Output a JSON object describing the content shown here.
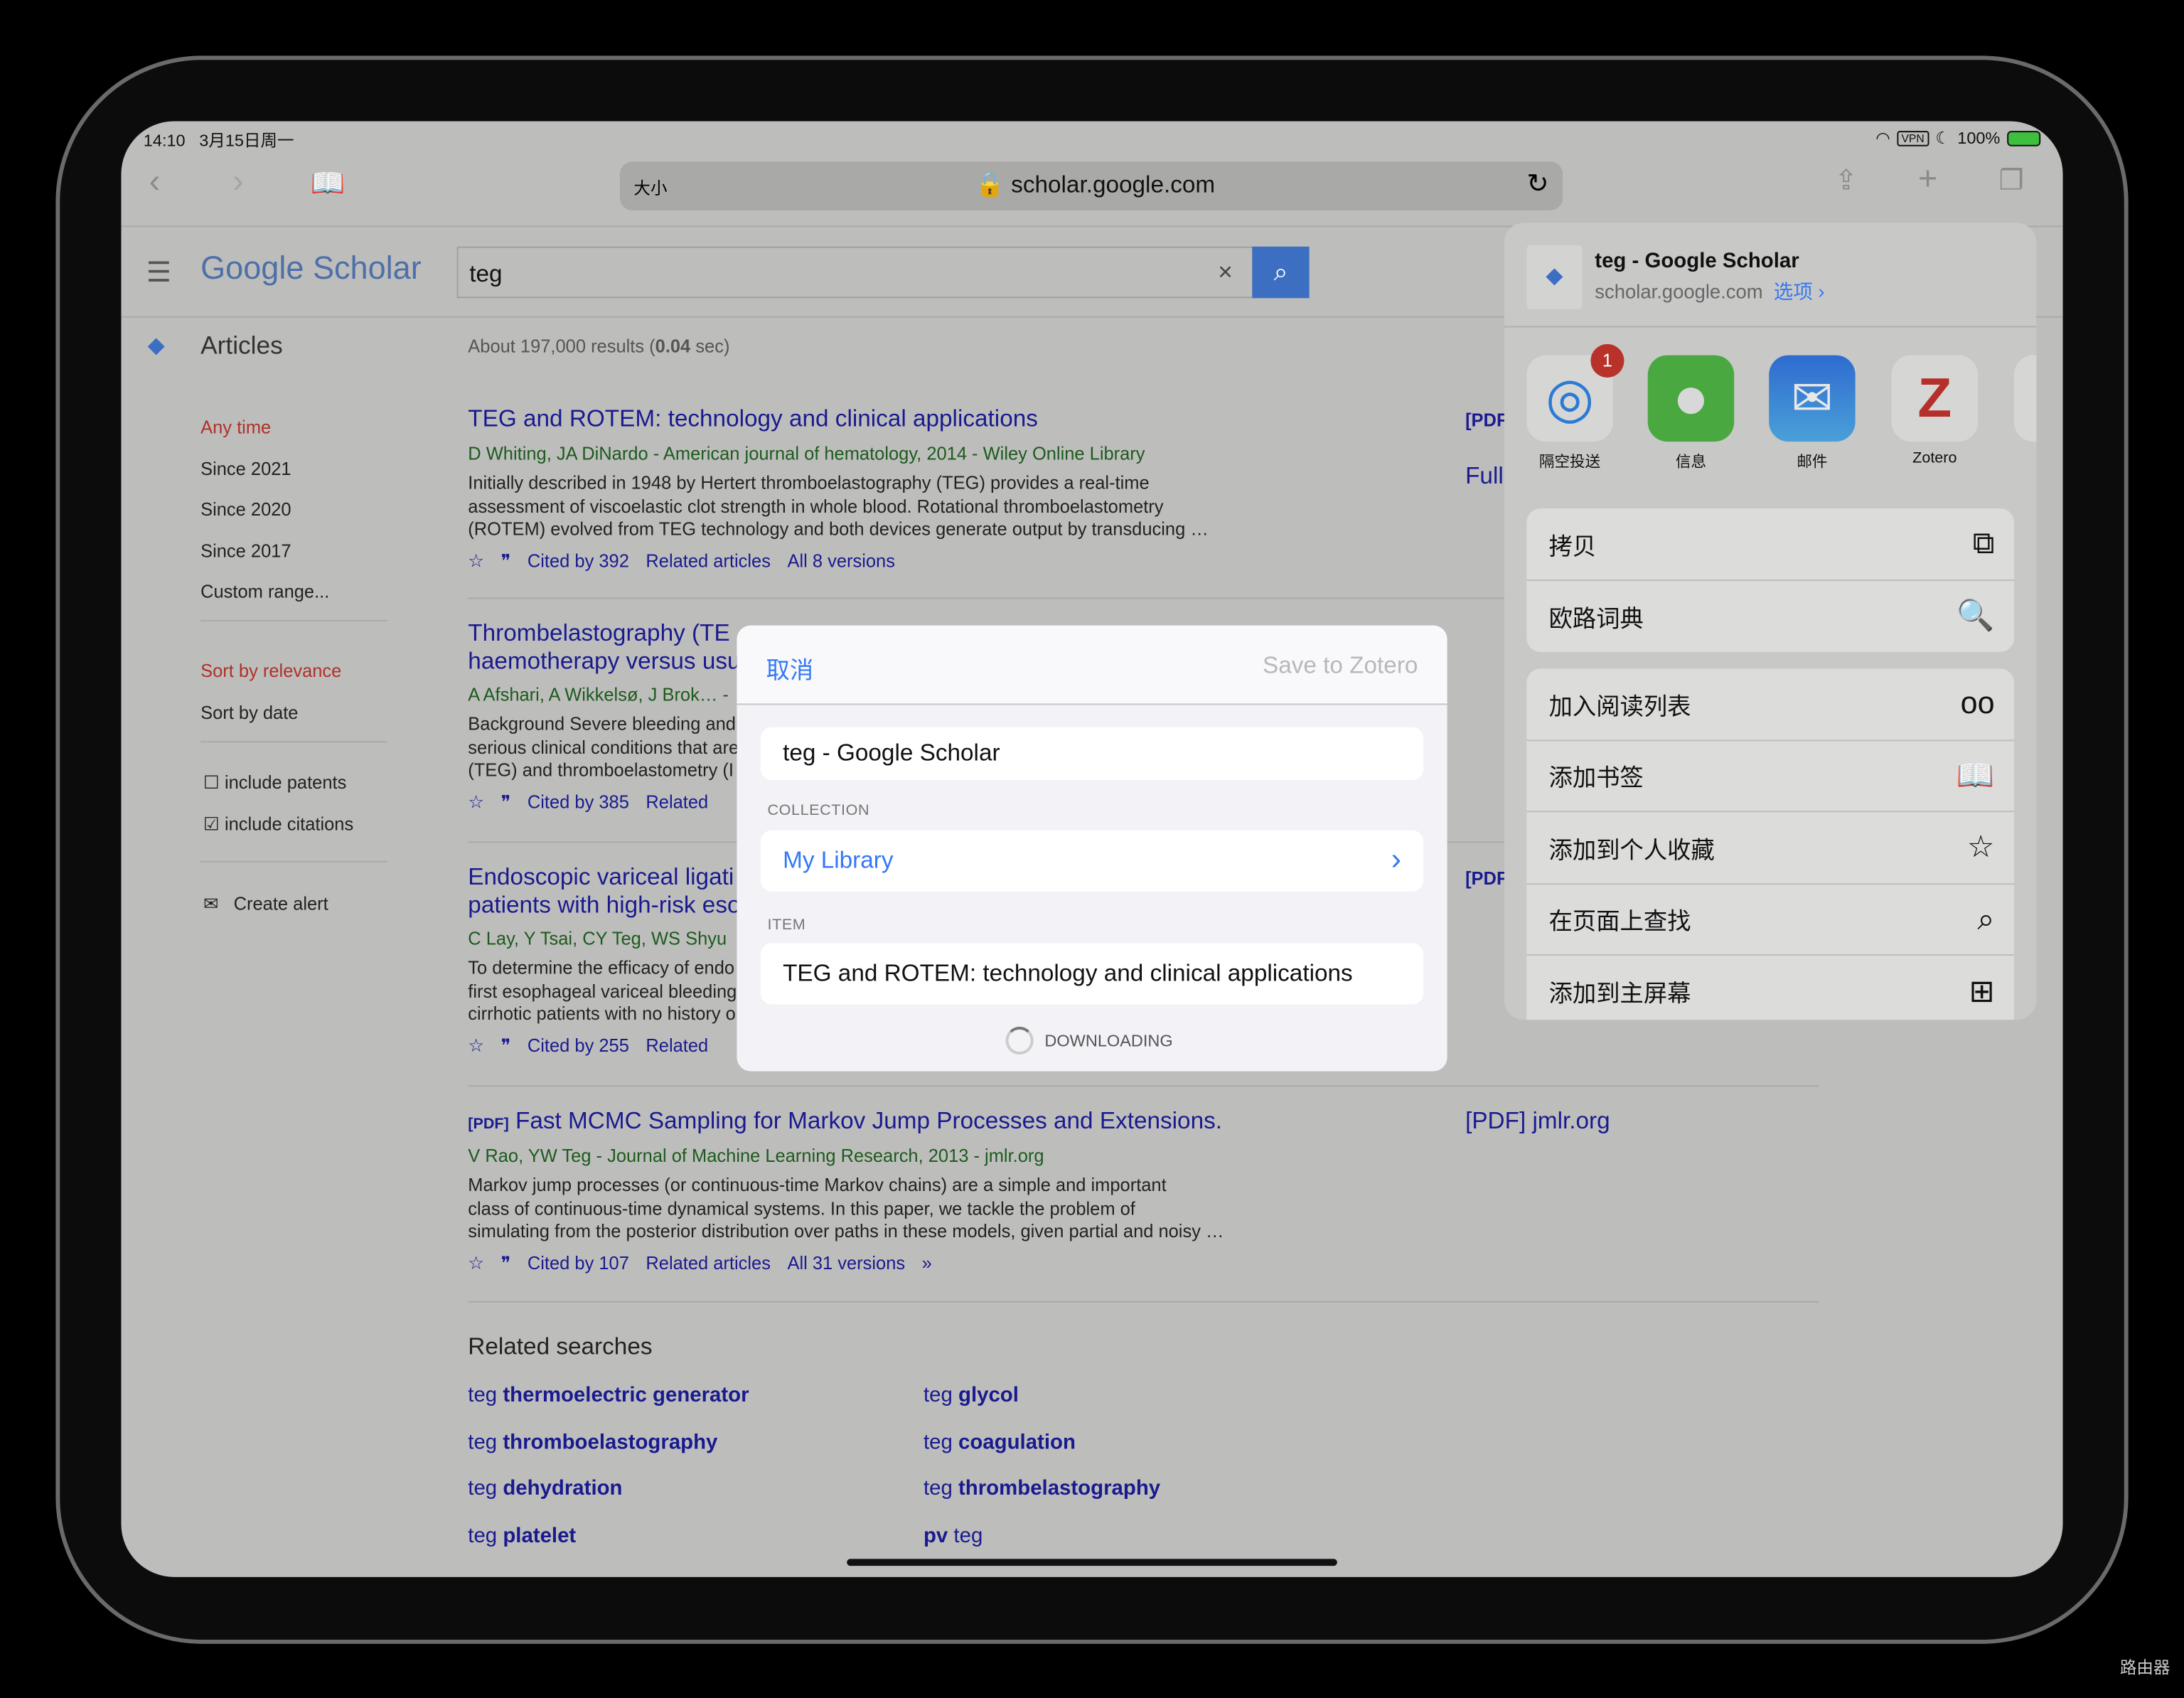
{
  "status": {
    "time": "14:10",
    "date": "3月15日周一",
    "vpn": "VPN",
    "battery": "100%"
  },
  "browser": {
    "text_size": "大小",
    "url": "scholar.google.com"
  },
  "scholar": {
    "logo": "Google Scholar",
    "query": "teg",
    "section": "Articles",
    "results_prefix": "About 197,000 results (",
    "results_time": "0.04",
    "results_suffix": " sec)"
  },
  "sidebar": {
    "time_filters": [
      "Any time",
      "Since 2021",
      "Since 2020",
      "Since 2017",
      "Custom range..."
    ],
    "sort": [
      "Sort by relevance",
      "Sort by date"
    ],
    "include_patents": "include patents",
    "include_citations": "include citations",
    "create_alert": "Create alert"
  },
  "results": [
    {
      "title": "TEG and ROTEM: technology and clinical applications",
      "authors": "D Whiting, JA DiNardo - American journal of hematology, 2014 - Wiley Online Library",
      "snippet": [
        "Initially described in 1948 by Hertert thromboelastography (TEG) provides a real-time",
        "assessment of viscoelastic clot strength in whole blood. Rotational thromboelastometry",
        "(ROTEM) evolved from TEG technology and both devices generate output by transducing …"
      ],
      "cited": "Cited by 392",
      "related": "Related articles",
      "versions": "All 8 versions",
      "side": "[PDF",
      "side2": "Full"
    },
    {
      "title": "Thrombelastography (TE",
      "title2": "haemotherapy versus usu",
      "authors": "A Afshari, A Wikkelsø, J Brok… -",
      "snippet": [
        "Background Severe bleeding and",
        "serious clinical conditions that are",
        "(TEG) and thromboelastometry (I"
      ],
      "cited": "Cited by 385",
      "related": "Related"
    },
    {
      "title": "Endoscopic variceal ligati",
      "title2": "patients with high-risk eso",
      "authors": "C Lay, Y Tsai, CY Teg, WS Shyu",
      "snippet": [
        "To determine the efficacy of endo",
        "first esophageal variceal bleeding",
        "cirrhotic patients with no history o"
      ],
      "cited": "Cited by 255",
      "related": "Related",
      "side": "[PDF"
    },
    {
      "pdf_tag": "[PDF]",
      "title": "Fast MCMC Sampling for Markov Jump Processes and Extensions.",
      "authors": "V Rao, YW Teg - Journal of Machine Learning Research, 2013 - jmlr.org",
      "snippet": [
        "Markov jump processes (or continuous-time Markov chains) are a simple and important",
        "class of continuous-time dynamical systems. In this paper, we tackle the problem of",
        "simulating from the posterior distribution over paths in these models, given partial and noisy …"
      ],
      "cited": "Cited by 107",
      "related": "Related articles",
      "versions": "All 31 versions",
      "side": "[PDF] jmlr.org"
    }
  ],
  "related_searches": {
    "heading": "Related searches",
    "items": [
      [
        "teg ",
        "thermoelectric generator"
      ],
      [
        "teg ",
        "glycol"
      ],
      [
        "teg ",
        "thromboelastography"
      ],
      [
        "teg ",
        "coagulation"
      ],
      [
        "teg ",
        "dehydration"
      ],
      [
        "teg ",
        "thrombelastography"
      ],
      [
        "teg ",
        "platelet"
      ],
      [
        "pv",
        " teg"
      ]
    ]
  },
  "zotero": {
    "cancel": "取消",
    "save": "Save to Zotero",
    "title": "teg - Google Scholar",
    "collection_label": "COLLECTION",
    "collection": "My Library",
    "item_label": "ITEM",
    "item": "TEG and ROTEM: technology and clinical applications",
    "status": "DOWNLOADING"
  },
  "share": {
    "title": "teg - Google Scholar",
    "domain": "scholar.google.com",
    "options": "选项 ›",
    "apps": [
      {
        "label": "隔空投送",
        "badge": "1"
      },
      {
        "label": "信息"
      },
      {
        "label": "邮件"
      },
      {
        "label": "Zotero"
      }
    ],
    "group1": [
      "拷贝",
      "欧路词典"
    ],
    "group2": [
      "加入阅读列表",
      "添加书签",
      "添加到个人收藏",
      "在页面上查找",
      "添加到主屏幕"
    ]
  },
  "watermark": "路由器",
  "colors": {
    "accent": "#3478f6",
    "scholar_blue": "#4285f4",
    "link": "#1a0dab",
    "active_red": "#c5221f"
  }
}
